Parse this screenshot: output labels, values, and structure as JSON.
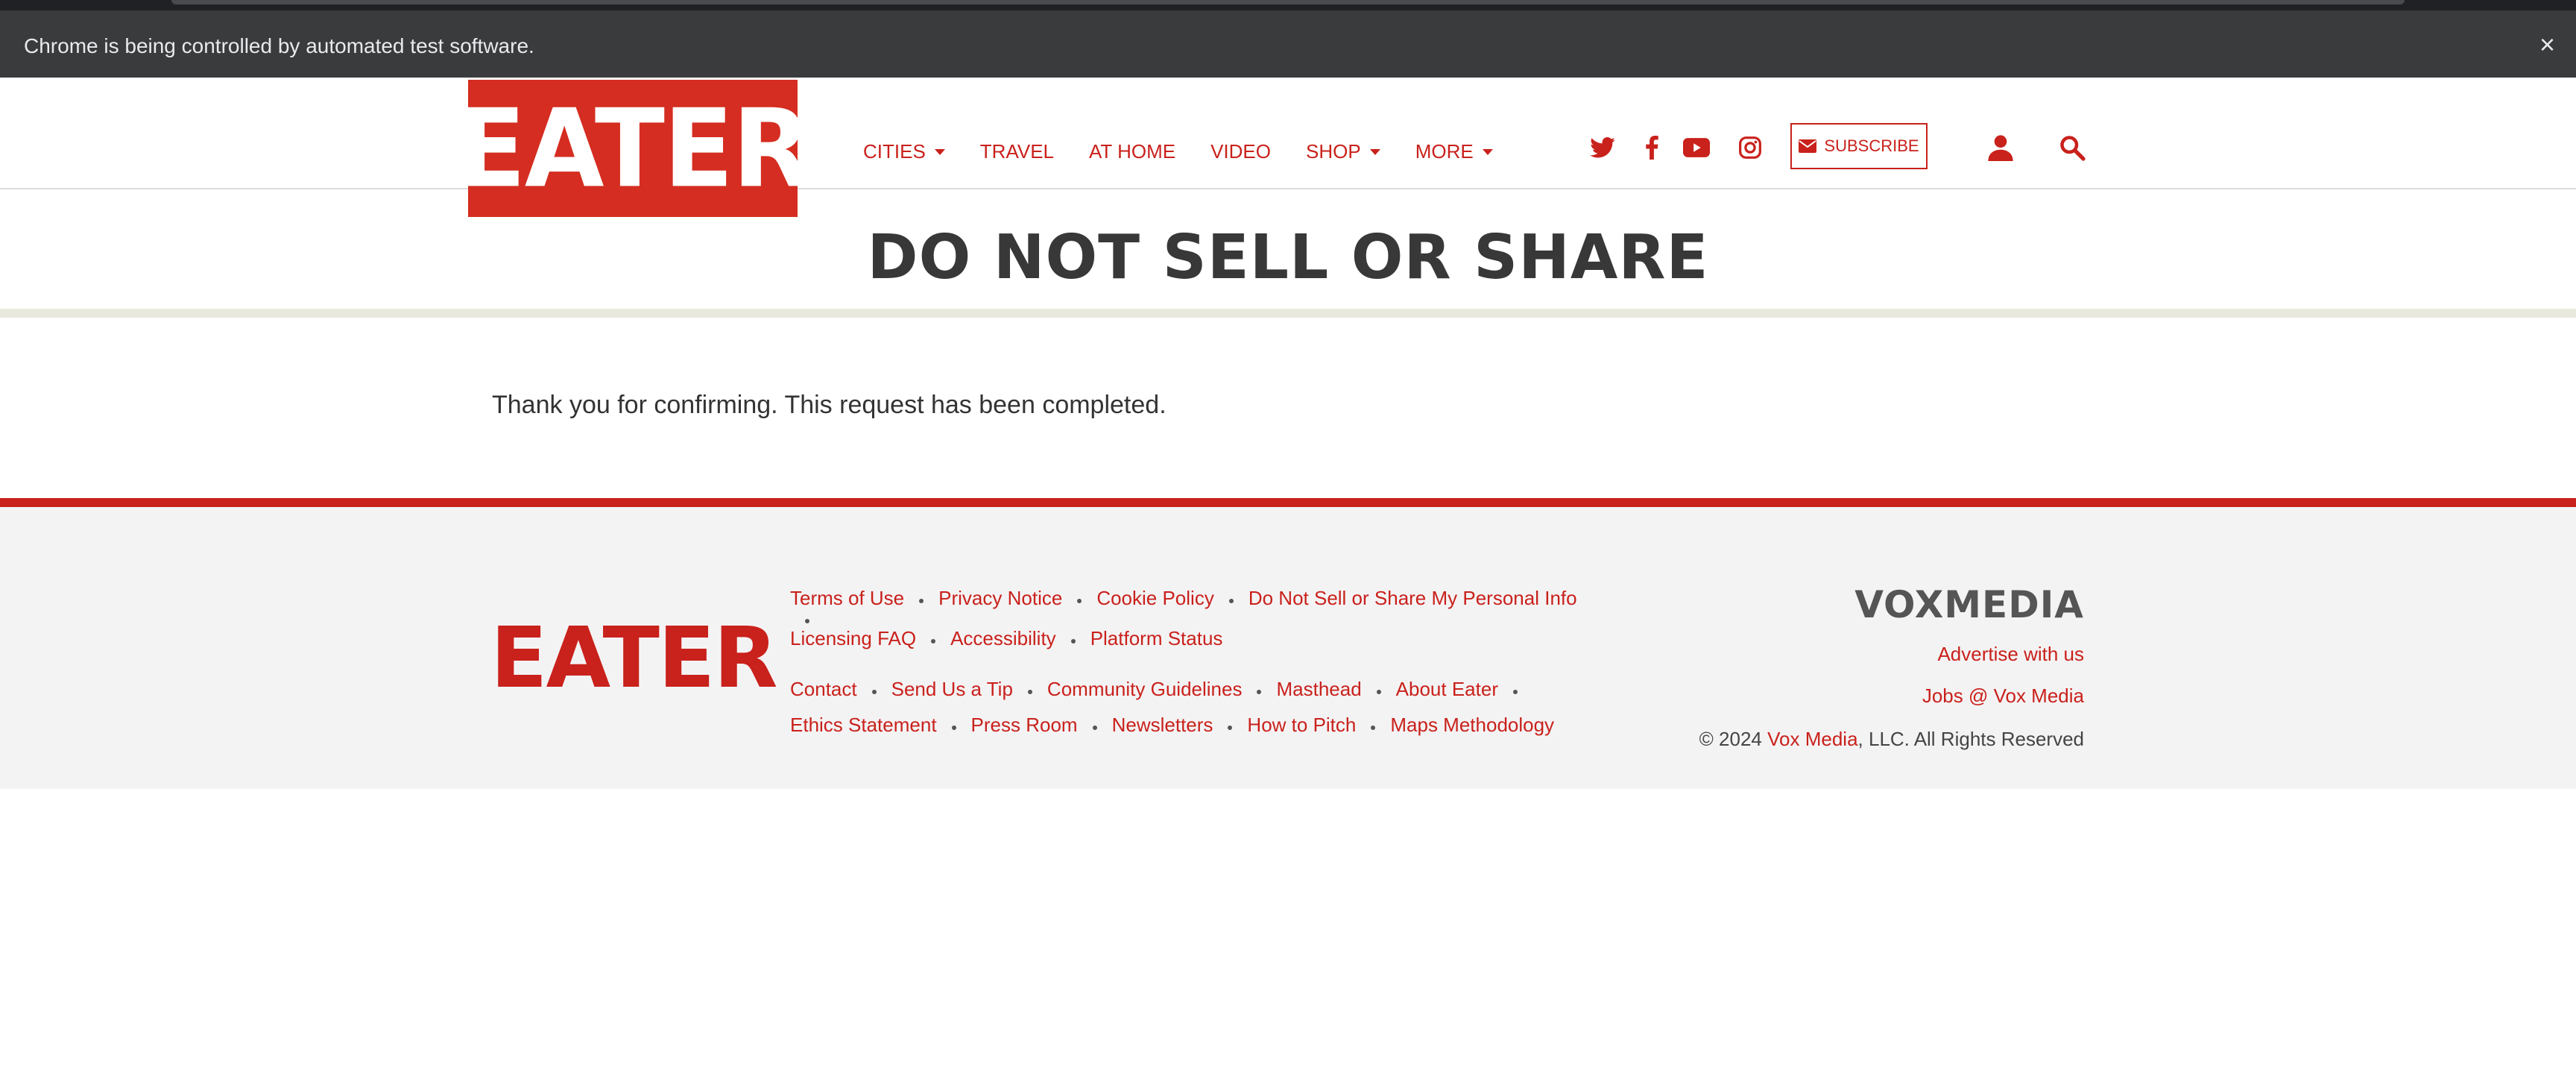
{
  "browser": {
    "automation_notice": "Chrome is being controlled by automated test software.",
    "close_glyph": "×"
  },
  "header": {
    "logo_text": "EATER",
    "nav": [
      {
        "label": "CITIES",
        "dropdown": true
      },
      {
        "label": "TRAVEL",
        "dropdown": false
      },
      {
        "label": "AT HOME",
        "dropdown": false
      },
      {
        "label": "VIDEO",
        "dropdown": false
      },
      {
        "label": "SHOP",
        "dropdown": true
      },
      {
        "label": "MORE",
        "dropdown": true
      }
    ],
    "social_icons": [
      "twitter-icon",
      "facebook-icon",
      "youtube-icon",
      "instagram-icon"
    ],
    "subscribe_label": "SUBSCRIBE",
    "brand_color": "#c9211b"
  },
  "main": {
    "title": "DO NOT SELL OR SHARE",
    "message": "Thank you for confirming. This request has been completed."
  },
  "footer": {
    "logo_text": "EATER",
    "links_group1_line1": [
      "Terms of Use",
      "Privacy Notice",
      "Cookie Policy",
      "Do Not Sell or Share My Personal Info"
    ],
    "links_group1_line2": [
      "Licensing FAQ",
      "Accessibility",
      "Platform Status"
    ],
    "links_group2_line1": [
      "Contact",
      "Send Us a Tip",
      "Community Guidelines",
      "Masthead",
      "About Eater"
    ],
    "links_group2_line2": [
      "Ethics Statement",
      "Press Room",
      "Newsletters",
      "How to Pitch",
      "Maps Methodology"
    ],
    "vox_logo": "VOXMEDIA",
    "advertise": "Advertise with us",
    "jobs": "Jobs @ Vox Media",
    "copyright_prefix": "© 2024 ",
    "copyright_link": "Vox Media",
    "copyright_suffix": ", LLC. All Rights Reserved"
  }
}
